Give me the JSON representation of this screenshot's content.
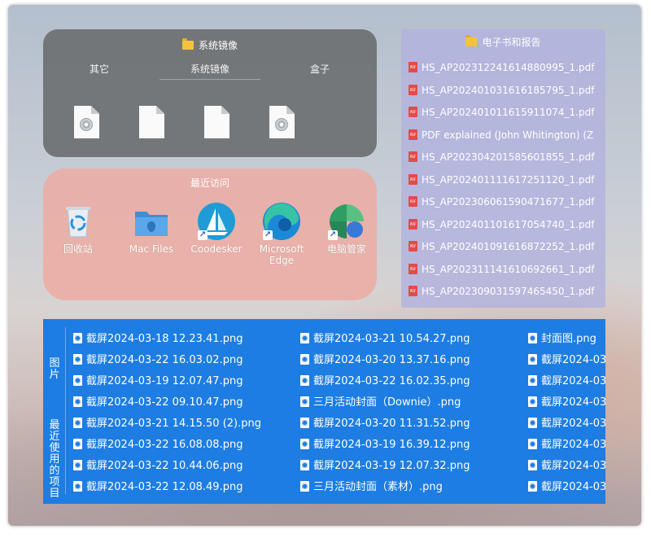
{
  "colors": {
    "system_panel": "#6c7071",
    "recent_panel": "#eeaaa0",
    "ebook_panel": "#b2b2de",
    "picture_panel": "#1d7de3"
  },
  "system_group": {
    "title": "系统镜像",
    "tabs": [
      {
        "label": "其它"
      },
      {
        "label": "系统镜像"
      },
      {
        "label": "盒子"
      }
    ],
    "active_tab": "系统镜像",
    "files": [
      {
        "icon": "disc-image-file-icon"
      },
      {
        "icon": "blank-file-icon"
      },
      {
        "icon": "blank-file-icon"
      },
      {
        "icon": "disc-image-file-icon"
      }
    ]
  },
  "recent_group": {
    "title": "最近访问",
    "apps": [
      {
        "label": "回收站",
        "icon": "recycle-bin-icon"
      },
      {
        "label": "Mac Files",
        "icon": "mac-folder-icon"
      },
      {
        "label": "Coodesker",
        "icon": "coodesker-icon"
      },
      {
        "label": "Microsoft Edge",
        "icon": "edge-icon"
      },
      {
        "label": "电脑管家",
        "icon": "pc-manager-icon"
      }
    ]
  },
  "ebook_group": {
    "title": "电子书和报告",
    "files": [
      "HS_AP202312241614880995_1.pdf",
      "HS_AP202401031616185795_1.pdf",
      "HS_AP202401011615911074_1.pdf",
      "PDF explained (John Whitington) (Z",
      "HS_AP202304201585601855_1.pdf",
      "HS_AP202401111617251120_1.pdf",
      "HS_AP202306061590471677_1.pdf",
      "HS_AP202401101617054740_1.pdf",
      "HS_AP202401091616872252_1.pdf",
      "HS_AP202311141610692661_1.pdf",
      "HS_AP202309031597465450_1.pdf"
    ]
  },
  "picture_group": {
    "tab_pictures": "图片",
    "tab_recent": "最近使用的项目",
    "col1": [
      "截屏2024-03-18 12.23.41.png",
      "截屏2024-03-22 16.03.02.png",
      "截屏2024-03-19 12.07.47.png",
      "截屏2024-03-22 09.10.47.png",
      "截屏2024-03-21 14.15.50 (2).png",
      "截屏2024-03-22 16.08.08.png",
      "截屏2024-03-22 10.44.06.png",
      "截屏2024-03-22 12.08.49.png"
    ],
    "col2": [
      "截屏2024-03-21 10.54.27.png",
      "截屏2024-03-20 13.37.16.png",
      "截屏2024-03-22 16.02.35.png",
      "三月活动封面（Downie）.png",
      "截屏2024-03-20 11.31.52.png",
      "截屏2024-03-19 16.39.12.png",
      "截屏2024-03-19 12.07.32.png",
      "三月活动封面（素材）.png"
    ],
    "col3": [
      "封面图.png",
      "截屏2024-03",
      "截屏2024-03",
      "截屏2024-03",
      "截屏2024-03",
      "截屏2024-03",
      "截屏2024-03",
      "截屏2024-03"
    ]
  }
}
